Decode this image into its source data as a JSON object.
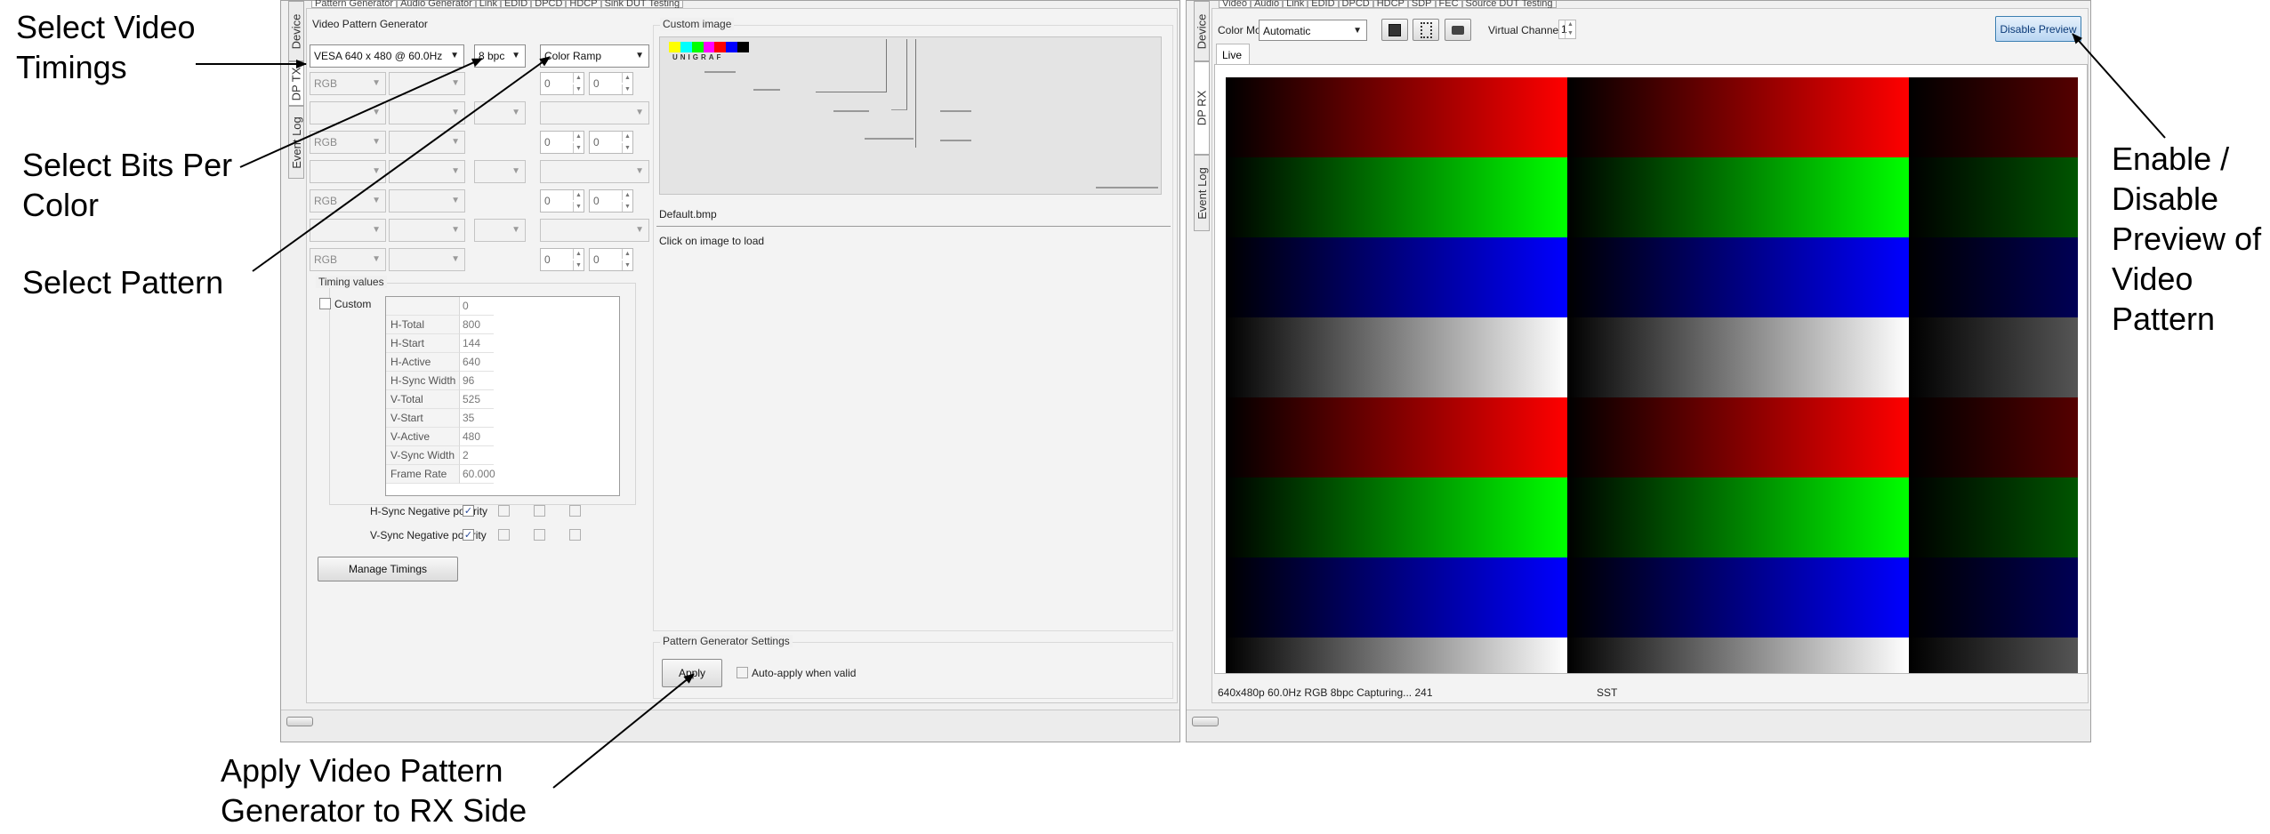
{
  "callouts": {
    "select_video_timings": [
      "Select Video",
      "Timings"
    ],
    "select_bits_per_color": [
      "Select Bits Per",
      "Color"
    ],
    "select_pattern": "Select Pattern",
    "apply_pattern": [
      "Apply Video Pattern",
      "Generator to RX Side"
    ],
    "enable_disable_preview": [
      "Enable /",
      "Disable",
      "Preview of",
      "Video",
      "Pattern"
    ]
  },
  "tx": {
    "side_tabs": [
      "Device",
      "DP TX",
      "Event Log"
    ],
    "top_tabs": [
      "Pattern Generator",
      "Audio Generator",
      "Link",
      "EDID",
      "DPCD",
      "HDCP",
      "Sink DUT Testing"
    ],
    "group_title": "Video Pattern Generator",
    "timing_combo": "VESA 640 x 480 @ 60.0Hz",
    "bpc_combo": "8 bpc",
    "pattern_combo": "Color Ramp",
    "rows": [
      {
        "format": "RGB",
        "spin_a": "0",
        "spin_b": "0"
      },
      {
        "format": "",
        "spin_a": "",
        "spin_b": ""
      },
      {
        "format": "RGB",
        "spin_a": "0",
        "spin_b": "0"
      },
      {
        "format": "",
        "spin_a": "",
        "spin_b": ""
      },
      {
        "format": "RGB",
        "spin_a": "0",
        "spin_b": "0"
      },
      {
        "format": "",
        "spin_a": "",
        "spin_b": ""
      },
      {
        "format": "RGB",
        "spin_a": "0",
        "spin_b": "0"
      }
    ],
    "timing_values_title": "Timing values",
    "custom_label": "Custom",
    "timing_table": [
      {
        "key": "",
        "value": "0"
      },
      {
        "key": "H-Total",
        "value": "800"
      },
      {
        "key": "H-Start",
        "value": "144"
      },
      {
        "key": "H-Active",
        "value": "640"
      },
      {
        "key": "H-Sync Width",
        "value": "96"
      },
      {
        "key": "V-Total",
        "value": "525"
      },
      {
        "key": "V-Start",
        "value": "35"
      },
      {
        "key": "V-Active",
        "value": "480"
      },
      {
        "key": "V-Sync Width",
        "value": "2"
      },
      {
        "key": "Frame Rate",
        "value": "60.000"
      }
    ],
    "hsync_label": "H-Sync Negative polarity",
    "vsync_label": "V-Sync Negative polarity",
    "manage_timings": "Manage Timings",
    "custom_image_title": "Custom image",
    "image_brand": "UNIGRAF",
    "image_file": "Default.bmp",
    "click_to_load": "Click on image to load",
    "settings_title": "Pattern Generator Settings",
    "apply_button": "Apply",
    "auto_apply_label": "Auto-apply when valid"
  },
  "rx": {
    "side_tabs": [
      "Device",
      "DP RX",
      "Event Log"
    ],
    "top_tabs": [
      "Video",
      "Audio",
      "Link",
      "EDID",
      "DPCD",
      "HDCP",
      "SDP",
      "FEC",
      "Source DUT Testing"
    ],
    "color_mode_label": "Color Mode",
    "color_mode_value": "Automatic",
    "virtual_channel_label": "Virtual Channel:",
    "virtual_channel_value": "1",
    "disable_preview": "Disable Preview",
    "live_tab": "Live",
    "status_text": "640x480p 60.0Hz RGB 8bpc Capturing... 241",
    "status_mode": "SST",
    "colors": {
      "red": "#ff0000",
      "green": "#00ff00",
      "blue": "#0000ff",
      "white": "#ffffff"
    }
  }
}
